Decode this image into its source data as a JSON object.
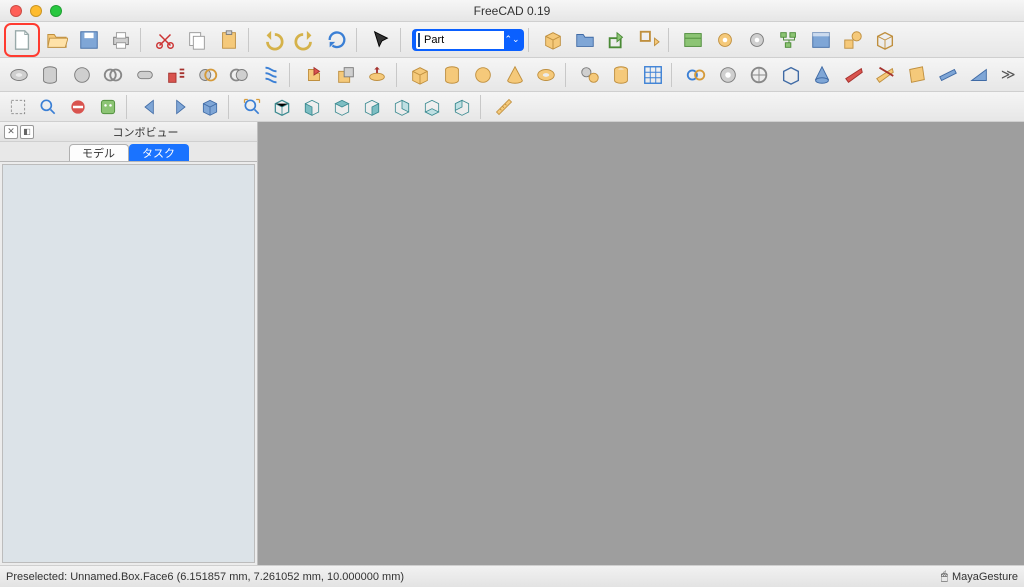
{
  "title": "FreeCAD 0.19",
  "workbench": {
    "value": "Part"
  },
  "panel": {
    "title": "コンボビュー",
    "tabs": {
      "model": "モデル",
      "task": "タスク",
      "active": "task"
    }
  },
  "status": {
    "left": "Preselected: Unnamed.Box.Face6 (6.151857 mm, 7.261052 mm, 10.000000 mm)",
    "right": "MayaGesture"
  },
  "row1_icons": [
    "new-document",
    "open-document",
    "save-document",
    "print",
    "cut",
    "copy",
    "paste",
    "undo",
    "redo",
    "refresh",
    "cursor-select"
  ],
  "row1b_icons": [
    "cube-gold",
    "folder-blue",
    "share-green",
    "link-gold",
    "board-green",
    "gear-gold",
    "gear-grey",
    "tree-green",
    "panel-blue",
    "shapes-gold",
    "wire-cube"
  ],
  "row2_icons": [
    "torus-grey",
    "cylinder-grey",
    "sphere-grey",
    "circle-grey",
    "capsule-grey",
    "extrude-red",
    "bool1",
    "bool2",
    "helix-blue",
    "union",
    "intersect",
    "revolve",
    "box-gold",
    "cylinder-gold",
    "sphere-gold",
    "cone-gold",
    "torus-gold",
    "gear-set",
    "tube-gold",
    "grid-blue",
    "rings-chain",
    "v1",
    "v2",
    "box-wire",
    "cone-rev",
    "plane-red",
    "plane-gold",
    "sheet-gold",
    "bar-blue",
    "wedge-blue"
  ],
  "row3_icons": [
    "bbox",
    "zoom",
    "no-entry",
    "bug-green",
    "arrow-left",
    "arrow-right",
    "cube-nav",
    "zoom-fit",
    "iso-1",
    "iso-2",
    "iso-3",
    "iso-4",
    "iso-5",
    "iso-6",
    "iso-7",
    "ruler"
  ]
}
